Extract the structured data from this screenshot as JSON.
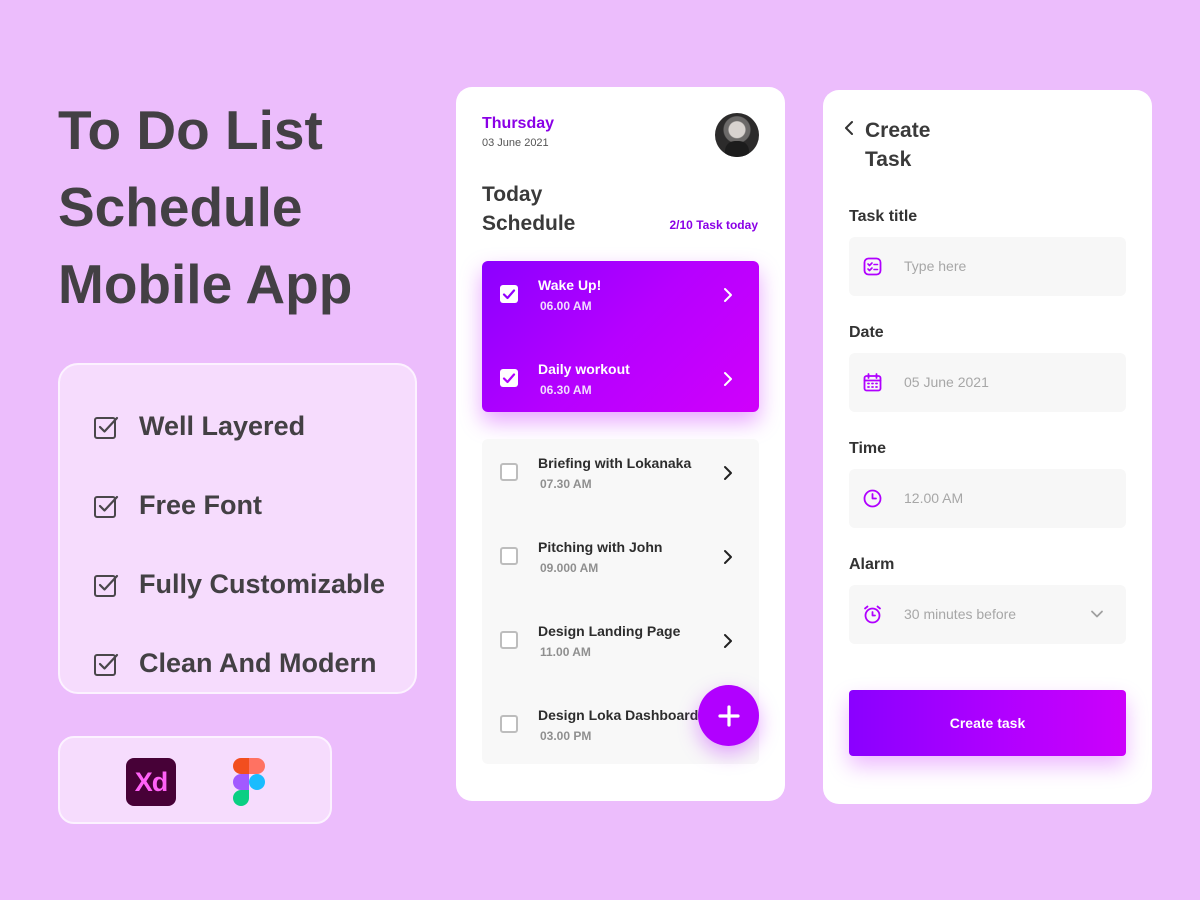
{
  "hero": {
    "line1": "To Do List",
    "line2": "Schedule",
    "line3": "Mobile App"
  },
  "features": [
    {
      "label": "Well Layered",
      "icon": "checkbox-icon"
    },
    {
      "label": "Free Font",
      "icon": "checkbox-icon"
    },
    {
      "label": "Fully Customizable",
      "icon": "checkbox-icon"
    },
    {
      "label": "Clean And Modern",
      "icon": "checkbox-icon"
    }
  ],
  "tools": {
    "xd_label": "Xd",
    "figma_icon": "figma-icon"
  },
  "schedule": {
    "day": "Thursday",
    "date": "03 June 2021",
    "title_line1": "Today",
    "title_line2": "Schedule",
    "task_count": "2/10 Task today",
    "done_tasks": [
      {
        "name": "Wake Up!",
        "time": "06.00 AM",
        "checked": true
      },
      {
        "name": "Daily workout",
        "time": "06.30 AM",
        "checked": true
      }
    ],
    "todo_tasks": [
      {
        "name": "Briefing with Lokanaka",
        "time": "07.30 AM",
        "checked": false
      },
      {
        "name": "Pitching with John",
        "time": "09.000 AM",
        "checked": false
      },
      {
        "name": "Design Landing Page",
        "time": "11.00 AM",
        "checked": false
      },
      {
        "name": "Design Loka Dashboard",
        "time": "03.00 PM",
        "checked": false
      }
    ],
    "fab_icon": "plus-icon"
  },
  "create": {
    "title_line1": "Create",
    "title_line2": "Task",
    "task_title_label": "Task title",
    "task_title_placeholder": "Type here",
    "date_label": "Date",
    "date_value": "05 June 2021",
    "time_label": "Time",
    "time_value": "12.00 AM",
    "alarm_label": "Alarm",
    "alarm_value": "30 minutes before",
    "button_label": "Create task"
  },
  "colors": {
    "background": "#ecbdfc",
    "accent": "#8a00e6",
    "gradient_start": "#8b00ff",
    "gradient_end": "#d000fb"
  }
}
